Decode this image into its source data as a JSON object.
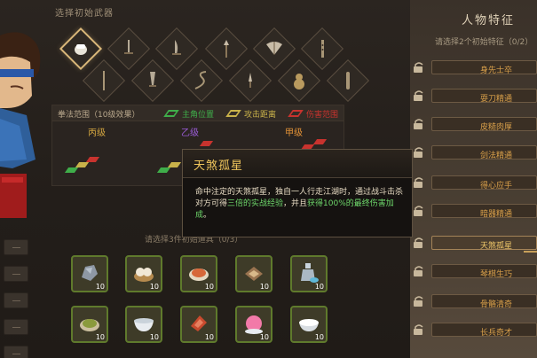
{
  "weapon_section": {
    "title": "选择初始武器"
  },
  "weapons": [
    {
      "name": "fist"
    },
    {
      "name": "sword"
    },
    {
      "name": "saber"
    },
    {
      "name": "spear"
    },
    {
      "name": "fan"
    },
    {
      "name": "flute"
    },
    {
      "name": "staff"
    },
    {
      "name": "blade"
    },
    {
      "name": "whip"
    },
    {
      "name": "dagger"
    },
    {
      "name": "gourd"
    },
    {
      "name": "club"
    }
  ],
  "range": {
    "title": "拳法范围（10级效果）",
    "legend": [
      {
        "label": "主角位置",
        "color": "#3fae4a"
      },
      {
        "label": "攻击距离",
        "color": "#c9b24a"
      },
      {
        "label": "伤害范围",
        "color": "#c8332e"
      }
    ],
    "tiers": [
      {
        "label": "丙级",
        "color": "#d4a640"
      },
      {
        "label": "乙级",
        "color": "#9a5cd6"
      },
      {
        "label": "甲级",
        "color": "#e39236"
      }
    ]
  },
  "tooltip": {
    "title": "天煞孤星",
    "body_1": "命中注定的天煞孤星，独自一人行走江湖时，通过战斗击杀对方可得",
    "body_2": "三倍的实战经验",
    "body_3": "，并且",
    "body_4": "获得100%的最终伤害加成",
    "body_5": "。"
  },
  "start_items": {
    "title": "请选择3件初始道具（0/3）",
    "quantity": "10",
    "items": [
      {
        "icon": "ore-icon"
      },
      {
        "icon": "bun-basket-icon"
      },
      {
        "icon": "dish-icon"
      },
      {
        "icon": "cake-icon"
      },
      {
        "icon": "wine-bottle-icon"
      },
      {
        "icon": "stir-fry-icon"
      },
      {
        "icon": "bowl-icon"
      },
      {
        "icon": "meat-icon"
      },
      {
        "icon": "peach-bun-icon"
      },
      {
        "icon": "rice-bowl-icon"
      }
    ]
  },
  "traits_panel": {
    "title": "人物特征",
    "subtitle": "请选择2个初始特征（0/2）",
    "traits": [
      {
        "label": "身先士卒",
        "active": false
      },
      {
        "label": "耍刀精通",
        "active": false
      },
      {
        "label": "皮糙肉厚",
        "active": false
      },
      {
        "label": "剑法精通",
        "active": false
      },
      {
        "label": "得心应手",
        "active": false
      },
      {
        "label": "暗器精通",
        "active": false
      },
      {
        "label": "天煞孤星",
        "active": true
      },
      {
        "label": "琴棋生巧",
        "active": false
      },
      {
        "label": "骨骼清奇",
        "active": false
      },
      {
        "label": "长兵奇才",
        "active": false
      }
    ]
  },
  "colors": {
    "accent": "#f0c65c",
    "trait_text": "#d9a04a",
    "item_border": "#5f7a2c"
  }
}
